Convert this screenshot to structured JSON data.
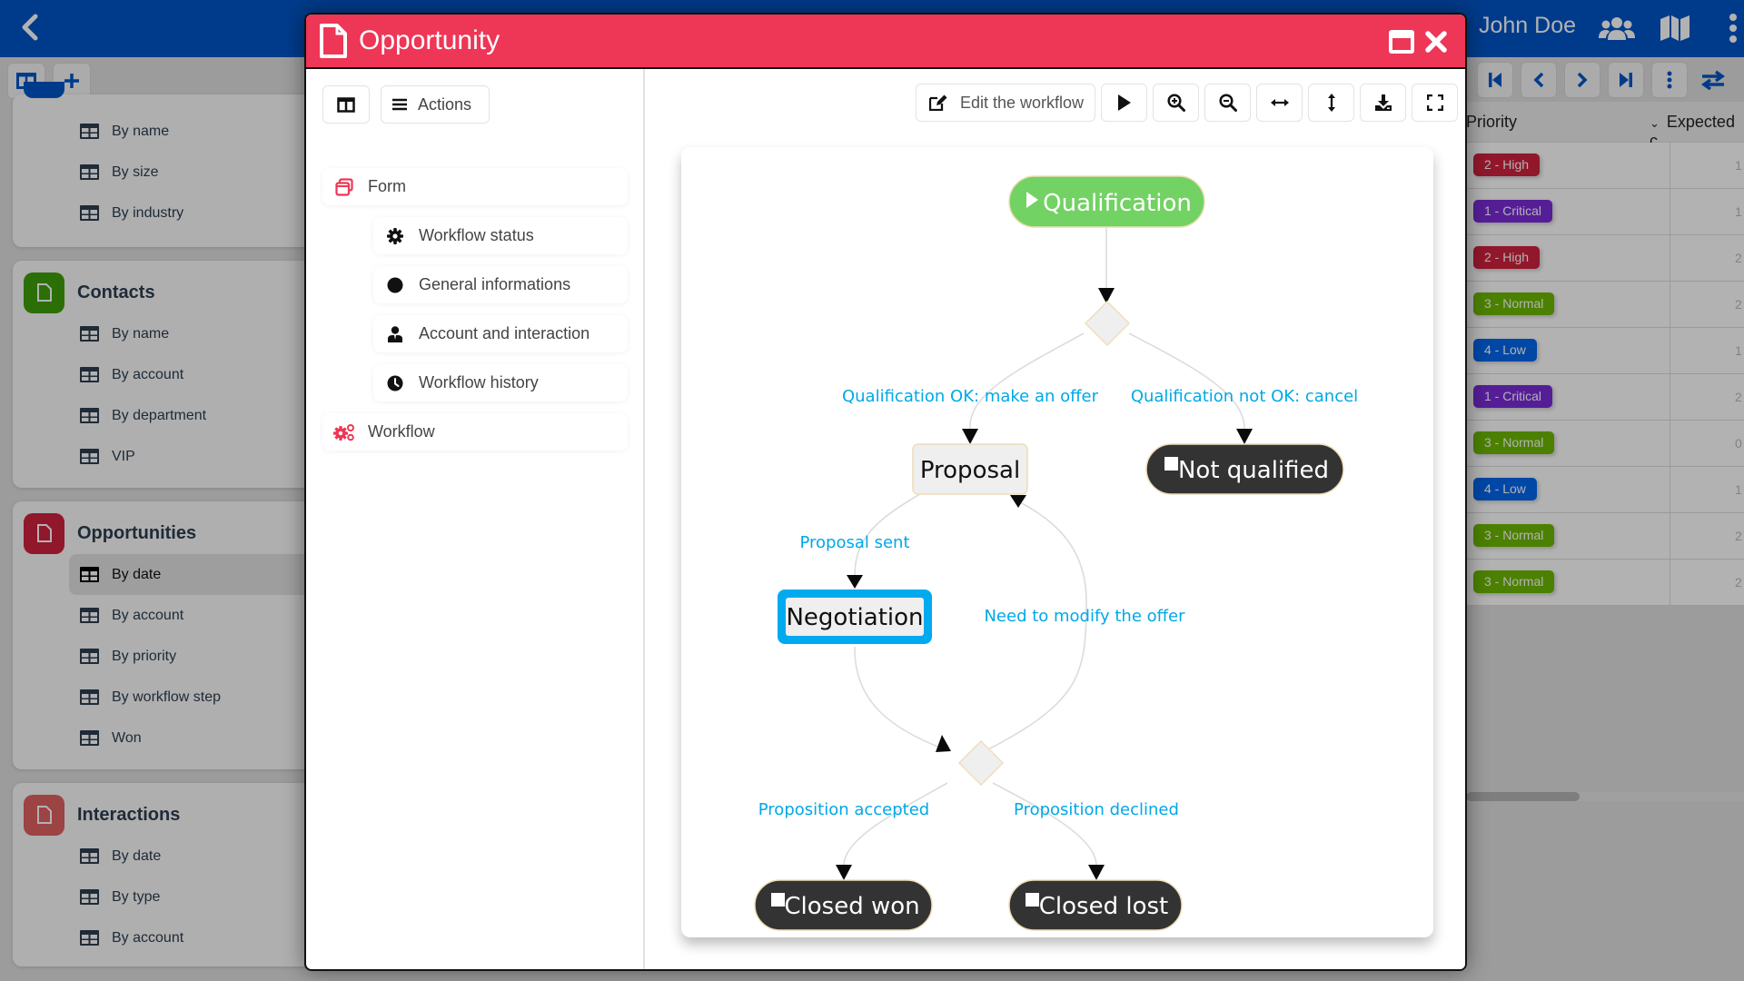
{
  "app": {
    "user_name": "John Doe",
    "header_icons": [
      "users-icon",
      "map-icon",
      "more-vertical-icon"
    ]
  },
  "sidebar": {
    "sections": [
      {
        "title": "",
        "color": "#0055c8",
        "items": [
          "By name",
          "By size",
          "By industry"
        ]
      },
      {
        "title": "Contacts",
        "color": "#3fa00a",
        "items": [
          "By name",
          "By account",
          "By department",
          "VIP"
        ]
      },
      {
        "title": "Opportunities",
        "color": "#d0213e",
        "items": [
          "By date",
          "By account",
          "By priority",
          "By workflow step",
          "Won"
        ],
        "active_index": 0
      },
      {
        "title": "Interactions",
        "color": "#e06060",
        "items": [
          "By date",
          "By type",
          "By account"
        ]
      }
    ]
  },
  "grid": {
    "columns": [
      "Priority",
      "Expected c"
    ],
    "rows": [
      {
        "priority": "2 - High",
        "color": "#d0213e",
        "value": "1"
      },
      {
        "priority": "1 - Critical",
        "color": "#7a2bd8",
        "value": "1"
      },
      {
        "priority": "2 - High",
        "color": "#d0213e",
        "value": "2"
      },
      {
        "priority": "3 - Normal",
        "color": "#6db800",
        "value": "2"
      },
      {
        "priority": "4 - Low",
        "color": "#0066ee",
        "value": "1"
      },
      {
        "priority": "1 - Critical",
        "color": "#7a2bd8",
        "value": "2"
      },
      {
        "priority": "3 - Normal",
        "color": "#6db800",
        "value": "0"
      },
      {
        "priority": "4 - Low",
        "color": "#0066ee",
        "value": "1"
      },
      {
        "priority": "3 - Normal",
        "color": "#6db800",
        "value": "2"
      },
      {
        "priority": "3 - Normal",
        "color": "#6db800",
        "value": "2"
      }
    ]
  },
  "modal": {
    "title": "Opportunity",
    "accent": "#ee3656",
    "actions_label": "Actions",
    "tree": [
      {
        "label": "Form",
        "icon": "form-icon",
        "level": 0
      },
      {
        "label": "Workflow status",
        "icon": "gear-icon",
        "level": 1
      },
      {
        "label": "General informations",
        "icon": "circle-icon",
        "level": 1
      },
      {
        "label": "Account and interaction",
        "icon": "user-tie-icon",
        "level": 1
      },
      {
        "label": "Workflow history",
        "icon": "clock-icon",
        "level": 1
      },
      {
        "label": "Workflow",
        "icon": "gears-icon",
        "level": 0
      }
    ],
    "toolbar": {
      "edit_label": "Edit the workflow",
      "buttons": [
        "play-icon",
        "zoom-in-icon",
        "zoom-out-icon",
        "fit-width-icon",
        "fit-height-icon",
        "download-icon",
        "fullscreen-icon"
      ]
    }
  },
  "workflow": {
    "nodes": {
      "qualification": {
        "label": "Qualification",
        "type": "start",
        "color": "#72d263"
      },
      "proposal": {
        "label": "Proposal",
        "type": "step"
      },
      "not_qualified": {
        "label": "Not qualified",
        "type": "end"
      },
      "negotiation": {
        "label": "Negotiation",
        "type": "current",
        "color": "#00aaee"
      },
      "closed_won": {
        "label": "Closed won",
        "type": "end"
      },
      "closed_lost": {
        "label": "Closed lost",
        "type": "end"
      }
    },
    "transitions": {
      "ok_offer": "Qualification OK: make an offer",
      "not_ok_cancel": "Qualification not OK: cancel",
      "proposal_sent": "Proposal sent",
      "modify_offer": "Need to modify the offer",
      "accepted": "Proposition accepted",
      "declined": "Proposition declined"
    },
    "label_color": "#00a8e8"
  }
}
